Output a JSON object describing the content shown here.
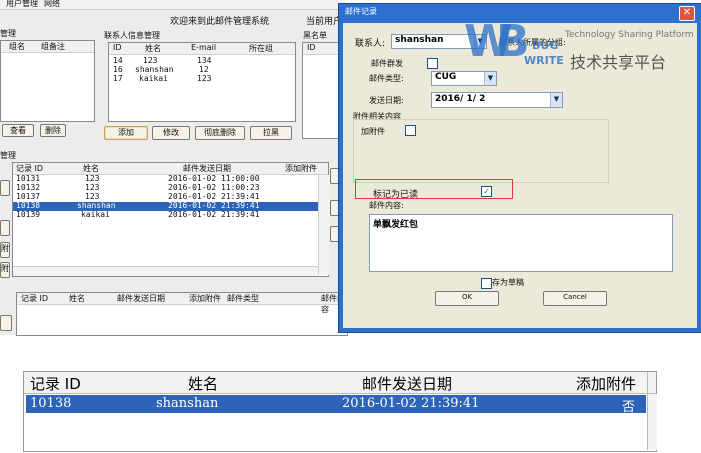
{
  "main": {
    "menu": [
      "用户管理",
      "网络"
    ],
    "welcome": "欢迎来到此邮件管理系统",
    "curr_user_label": "当前用户",
    "group_title": "管理",
    "group_cols": [
      "组名",
      "组备注"
    ],
    "group_btns": [
      "查看",
      "删除"
    ],
    "contact_title": "联系人信息管理",
    "contact_cols": [
      "ID",
      "姓名",
      "E-mail",
      "所在组"
    ],
    "contacts": [
      [
        "14",
        "123",
        "134",
        ""
      ],
      [
        "16",
        "shanshan",
        "12",
        ""
      ],
      [
        "17",
        "kaikai",
        "123",
        ""
      ]
    ],
    "contact_btns": [
      "添加",
      "修改",
      "彻底删除",
      "拉黑"
    ],
    "black_title": "黑名单",
    "black_cols": [
      "ID",
      ""
    ],
    "mail_title": "管理",
    "mail_cols": [
      "记录 ID",
      "姓名",
      "邮件发送日期",
      "添加附件"
    ],
    "mails": [
      [
        "10131",
        "123",
        "2016-01-02 11:00:00",
        ""
      ],
      [
        "10132",
        "123",
        "2016-01-02 11:00:23",
        ""
      ],
      [
        "10137",
        "123",
        "2016-01-02 21:39:41",
        ""
      ],
      [
        "10138",
        "shanshan",
        "2016-01-02 21:39:41",
        ""
      ],
      [
        "10139",
        "kaikai",
        "2016-01-02 21:39:41",
        ""
      ]
    ],
    "side_btns": [
      "附",
      "附"
    ],
    "lower_cols": [
      "记录 ID",
      "姓名",
      "邮件发送日期",
      "添加附件",
      "邮件类型",
      "邮件内容"
    ]
  },
  "dialog": {
    "title": "邮件记录",
    "contact_label": "联系人:",
    "contact_value": "shanshan",
    "group_label": "联系人所属的分组:",
    "group_send_label": "邮件群发",
    "type_label": "邮件类型:",
    "type_value": "CUG",
    "date_label": "发送日期:",
    "date_value": "2016/ 1/ 2",
    "attach_section": "附件相关内容",
    "add_attach_label": "加附件",
    "mark_read_label": "标记为已读",
    "content_label": "邮件内容:",
    "content_value": "单飘发红包",
    "draft_label": "存为草稿",
    "ok": "OK",
    "cancel": "Cancel"
  },
  "watermark": {
    "logo_letters": "WB",
    "logo_sub1": "BUG",
    "logo_sub2": "WRITE",
    "tagline": "Technology Sharing Platform",
    "cn": "技术共享平台"
  },
  "zoom": {
    "cols": [
      "记录 ID",
      "姓名",
      "邮件发送日期",
      "添加附件"
    ],
    "row": [
      "10138",
      "shanshan",
      "2016-01-02 21:39:41",
      "否"
    ]
  },
  "colors": {
    "selection": "#2d63b8",
    "dialog_title": "#2f6fd0",
    "highlight_box": "#d93a3a"
  }
}
